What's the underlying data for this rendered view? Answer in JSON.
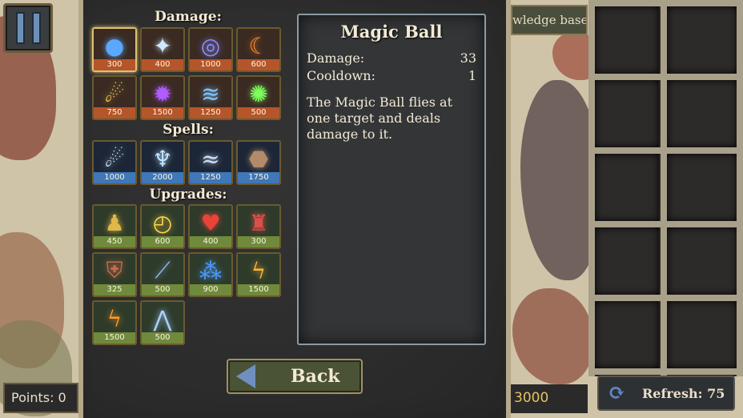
{
  "sections": {
    "damage_title": "Damage:",
    "spells_title": "Spells:",
    "upgrades_title": "Upgrades:"
  },
  "damage": [
    {
      "icon": "magic-ball-icon",
      "glyph": "●",
      "color": "#5aa8ff",
      "cost": "300"
    },
    {
      "icon": "ice-shards-icon",
      "glyph": "✦",
      "color": "#cfe8ff",
      "cost": "400"
    },
    {
      "icon": "lightning-ring-icon",
      "glyph": "◎",
      "color": "#8a8cff",
      "cost": "1000"
    },
    {
      "icon": "fire-claw-icon",
      "glyph": "☾",
      "color": "#ff8a2a",
      "cost": "600"
    },
    {
      "icon": "fire-comet-icon",
      "glyph": "☄",
      "color": "#ffd24a",
      "cost": "750"
    },
    {
      "icon": "purple-blast-icon",
      "glyph": "✹",
      "color": "#b05cff",
      "cost": "1500"
    },
    {
      "icon": "whirlwind-icon",
      "glyph": "≋",
      "color": "#7fc4ff",
      "cost": "1250"
    },
    {
      "icon": "acid-splash-icon",
      "glyph": "✺",
      "color": "#7cff5a",
      "cost": "500"
    }
  ],
  "spells": [
    {
      "icon": "frost-comet-icon",
      "glyph": "☄",
      "color": "#d8ecff",
      "cost": "1000"
    },
    {
      "icon": "ice-spikes-icon",
      "glyph": "♆",
      "color": "#bfe2ff",
      "cost": "2000"
    },
    {
      "icon": "wind-wave-icon",
      "glyph": "≈",
      "color": "#cfe4ff",
      "cost": "1250"
    },
    {
      "icon": "earth-rock-icon",
      "glyph": "⬣",
      "color": "#b38a6a",
      "cost": "1750"
    }
  ],
  "upgrades": [
    {
      "icon": "golden-golem-icon",
      "glyph": "♟",
      "color": "#e0b84a",
      "cost": "450"
    },
    {
      "icon": "golden-clock-icon",
      "glyph": "◴",
      "color": "#ffd84a",
      "cost": "600"
    },
    {
      "icon": "heart-icon",
      "glyph": "♥",
      "color": "#e8443a",
      "cost": "400"
    },
    {
      "icon": "red-tower-icon",
      "glyph": "♜",
      "color": "#d8504a",
      "cost": "300"
    },
    {
      "icon": "shield-icon",
      "glyph": "⛨",
      "color": "#c86a4a",
      "cost": "325"
    },
    {
      "icon": "blue-spear-icon",
      "glyph": "⟋",
      "color": "#8fb4e8",
      "cost": "500"
    },
    {
      "icon": "blue-orbs-icon",
      "glyph": "⁂",
      "color": "#4a9aff",
      "cost": "900"
    },
    {
      "icon": "lightning-bolts-icon",
      "glyph": "ϟ",
      "color": "#ffb43a",
      "cost": "1500"
    },
    {
      "icon": "lightning-burst-icon",
      "glyph": "ϟ",
      "color": "#ff9a2a",
      "cost": "1500"
    },
    {
      "icon": "ice-crystals-icon",
      "glyph": "⋀",
      "color": "#a8d0ff",
      "cost": "500"
    }
  ],
  "detail": {
    "title": "Magic Ball",
    "damage_label": "Damage:",
    "damage_value": "33",
    "cooldown_label": "Cooldown:",
    "cooldown_value": "1",
    "description": "The Magic Ball flies at one target and deals damage to it."
  },
  "back_label": "Back",
  "points_text": "Points: 0",
  "knowledge_base_label": "wledge base",
  "gold_value": "3000",
  "refresh_text": "Refresh: 75"
}
